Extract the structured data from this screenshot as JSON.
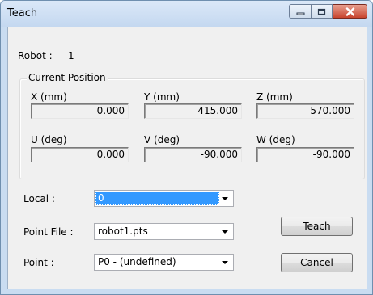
{
  "window": {
    "title": "Teach"
  },
  "robot": {
    "label": "Robot :",
    "value": "1"
  },
  "current_position": {
    "title": "Current Position",
    "coords": [
      {
        "label": "X (mm)",
        "value": "0.000"
      },
      {
        "label": "Y (mm)",
        "value": "415.000"
      },
      {
        "label": "Z (mm)",
        "value": "570.000"
      },
      {
        "label": "U (deg)",
        "value": "0.000"
      },
      {
        "label": "V (deg)",
        "value": "-90.000"
      },
      {
        "label": "W (deg)",
        "value": "-90.000"
      }
    ]
  },
  "fields": {
    "local": {
      "label": "Local :",
      "value": "0"
    },
    "point_file": {
      "label": "Point File :",
      "value": "robot1.pts"
    },
    "point": {
      "label": "Point :",
      "value": "P0 - (undefined)"
    }
  },
  "buttons": {
    "teach": "Teach",
    "cancel": "Cancel"
  },
  "colors": {
    "selection": "#3399ff",
    "close_button": "#c8442e",
    "titlebar": "#c9dcf1"
  },
  "icons": {
    "minimize": "minimize-icon",
    "maximize": "maximize-icon",
    "close": "close-icon",
    "dropdown": "chevron-down-icon"
  }
}
